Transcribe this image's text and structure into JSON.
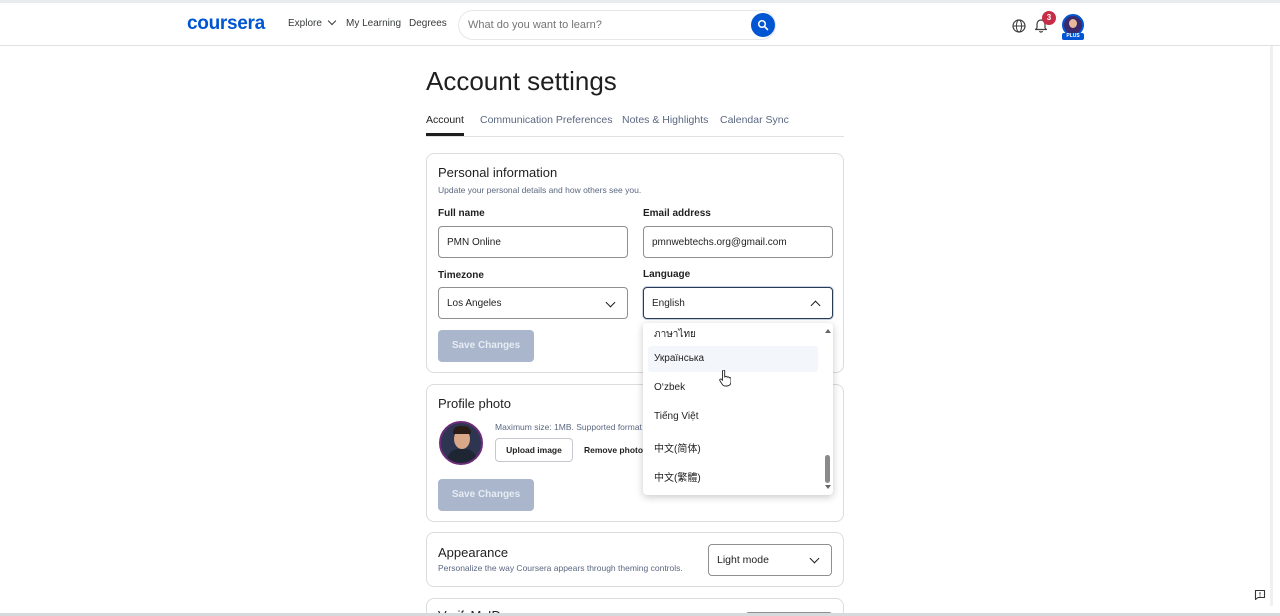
{
  "header": {
    "logo": "coursera",
    "nav": {
      "explore": "Explore",
      "my_learning": "My Learning",
      "degrees": "Degrees"
    },
    "search": {
      "placeholder": "What do you want to learn?"
    },
    "notifications_count": "3",
    "plus_label": "PLUS"
  },
  "page": {
    "title": "Account settings",
    "tabs": [
      {
        "label": "Account",
        "active": true
      },
      {
        "label": "Communication Preferences",
        "active": false
      },
      {
        "label": "Notes & Highlights",
        "active": false
      },
      {
        "label": "Calendar Sync",
        "active": false
      }
    ]
  },
  "personal": {
    "title": "Personal information",
    "subtitle": "Update your personal details and how others see you.",
    "full_name_label": "Full name",
    "full_name_value": "PMN Online",
    "email_label": "Email address",
    "email_value": "pmnwebtechs.org@gmail.com",
    "timezone_label": "Timezone",
    "timezone_value": "Los Angeles",
    "language_label": "Language",
    "language_value": "English",
    "save_label": "Save Changes"
  },
  "photo": {
    "title": "Profile photo",
    "info": "Maximum size: 1MB. Supported format",
    "upload_label": "Upload image",
    "remove_label": "Remove photo",
    "save_label": "Save Changes"
  },
  "appearance": {
    "title": "Appearance",
    "subtitle": "Personalize the way Coursera appears through theming controls.",
    "mode_value": "Light mode"
  },
  "verify": {
    "title": "VerifyMyID"
  },
  "language_dropdown": {
    "options": [
      "ภาษาไทย",
      "Українська",
      "O‘zbek",
      "Tiếng Việt",
      "中文(简体)",
      "中文(繁體)"
    ],
    "hovered": "Українська"
  },
  "colors": {
    "brand": "#0056d2",
    "badge": "#c72c48",
    "disabled_button": "#a9b6cc"
  }
}
